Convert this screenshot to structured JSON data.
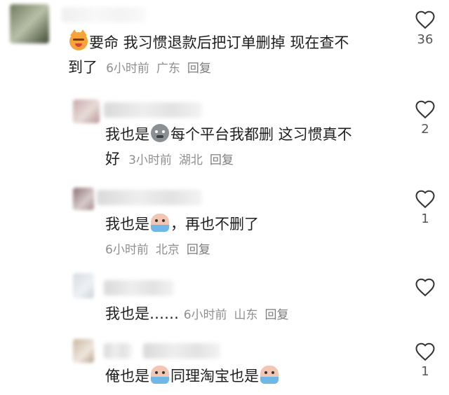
{
  "comments": [
    {
      "parts": [
        "要命 我习惯退款后把订单删掉 现在查不",
        "到了"
      ],
      "emoji": "cat-crying-icon",
      "time": "6小时前",
      "location": "广东",
      "reply": "回复",
      "likes": "36"
    },
    {
      "parts": [
        "我也是",
        "每个平台我都删 这习惯真不",
        "好"
      ],
      "emoji": "grey-sad-face-icon",
      "time": "3小时前",
      "location": "湖北",
      "reply": "回复",
      "likes": "2"
    },
    {
      "parts": [
        "我也是",
        "，再也不删了"
      ],
      "emoji": "crying-tears-icon",
      "time": "6小时前",
      "location": "北京",
      "reply": "回复",
      "likes": "1"
    },
    {
      "parts": [
        "我也是……"
      ],
      "time": "6小时前",
      "location": "山东",
      "reply": "回复",
      "likes": ""
    },
    {
      "parts": [
        "俺也是",
        "同理淘宝也是"
      ],
      "emoji": "crying-tears-icon",
      "likes": "1"
    }
  ]
}
